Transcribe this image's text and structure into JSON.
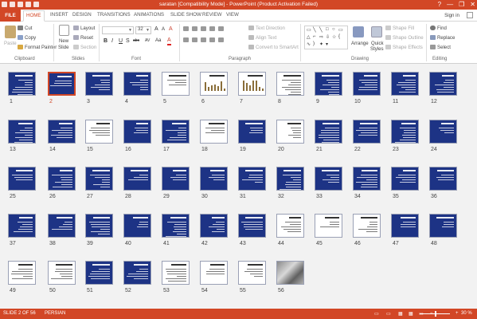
{
  "titlebar": {
    "title": "saratan [Compatibility Mode] - PowerPoint (Product Activation Failed)",
    "help": "?",
    "minimize": "—",
    "restore": "❐",
    "close": "✕"
  },
  "tabs": {
    "file": "FILE",
    "home": "HOME",
    "insert": "INSERT",
    "design": "DESIGN",
    "transitions": "TRANSITIONS",
    "animations": "ANIMATIONS",
    "slideshow": "SLIDE SHOW",
    "review": "REVIEW",
    "view": "VIEW",
    "signin": "Sign in"
  },
  "ribbon": {
    "clipboard": {
      "paste": "Paste",
      "cut": "Cut",
      "copy": "Copy",
      "format_painter": "Format Painter",
      "label": "Clipboard"
    },
    "slides": {
      "new_slide": "New",
      "new_slide2": "Slide",
      "layout": "Layout",
      "reset": "Reset",
      "section": "Section",
      "label": "Slides"
    },
    "font": {
      "font_name": "",
      "font_size": "32",
      "grow": "A",
      "shrink": "A",
      "clear": "A",
      "bold": "B",
      "italic": "I",
      "underline": "U",
      "strike": "S",
      "abc": "abc",
      "spacing": "AV",
      "case": "Aa",
      "color": "A",
      "label": "Font"
    },
    "paragraph": {
      "text_direction": "Text Direction",
      "align_text": "Align Text",
      "convert_smartart": "Convert to SmartArt",
      "label": "Paragraph"
    },
    "drawing": {
      "arrange": "Arrange",
      "quick_styles": "Quick",
      "quick_styles2": "Styles",
      "shape_fill": "Shape Fill",
      "shape_outline": "Shape Outline",
      "shape_effects": "Shape Effects",
      "label": "Drawing"
    },
    "editing": {
      "find": "Find",
      "replace": "Replace",
      "select": "Select",
      "label": "Editing"
    }
  },
  "slides": {
    "selected": 2,
    "numbers": [
      "1",
      "2",
      "3",
      "4",
      "5",
      "6",
      "7",
      "8",
      "9",
      "10",
      "11",
      "12",
      "13",
      "14",
      "15",
      "16",
      "17",
      "18",
      "19",
      "20",
      "21",
      "22",
      "23",
      "24",
      "25",
      "26",
      "27",
      "28",
      "29",
      "30",
      "31",
      "32",
      "33",
      "34",
      "35",
      "36",
      "37",
      "38",
      "39",
      "40",
      "41",
      "42",
      "43",
      "44",
      "45",
      "46",
      "47",
      "48",
      "49",
      "50",
      "51",
      "52",
      "53",
      "54",
      "55",
      "56"
    ],
    "white_slides": [
      5,
      6,
      7,
      8,
      15,
      18,
      20,
      44,
      45,
      46,
      49,
      50,
      53,
      54,
      55
    ],
    "chart_slides": [
      6,
      7
    ],
    "photo_slides": [
      56
    ],
    "slide_texts": {
      "1": "سرطان\nCancer",
      "31": "سرطان ریه\nLung Cancer",
      "35": "",
      "47": "سرطان کولورکتال\nColorectal Cancer",
      "51": "سرطان دهانه رحم\nCervical Cancer",
      "28": "سرطان پستان",
      "43": "سرطان معده"
    }
  },
  "status": {
    "slide_info": "SLIDE 2 OF 56",
    "language": "PERSIAN",
    "zoom": "30 %"
  }
}
